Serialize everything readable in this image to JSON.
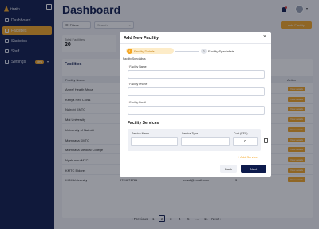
{
  "brand": {
    "name": "Health"
  },
  "sidebar": {
    "items": [
      {
        "label": "Dashboard"
      },
      {
        "label": "Facilities"
      },
      {
        "label": "Statistics"
      },
      {
        "label": "Staff"
      },
      {
        "label": "Settings",
        "badge": "New"
      }
    ]
  },
  "header": {
    "title": "Dashboard"
  },
  "toolbar": {
    "filters_label": "Filters",
    "search_placeholder": "Search",
    "add_facility_label": "Add Facility"
  },
  "stats": {
    "total_label": "Total Facilities",
    "total_value": "20"
  },
  "table": {
    "heading": "Facilities",
    "columns": [
      "Facility Name",
      "Phone",
      "Email",
      "Services",
      "Action"
    ],
    "rows": [
      {
        "name": "Amref Health Africa",
        "phone": "",
        "email": "",
        "services": ""
      },
      {
        "name": "Kenya Red Cross",
        "phone": "",
        "email": "",
        "services": ""
      },
      {
        "name": "Nairobi KMTC",
        "phone": "",
        "email": "",
        "services": ""
      },
      {
        "name": "Moi University",
        "phone": "",
        "email": "",
        "services": ""
      },
      {
        "name": "University of Nairobi",
        "phone": "",
        "email": "",
        "services": ""
      },
      {
        "name": "Mombasa KMTC",
        "phone": "",
        "email": "",
        "services": ""
      },
      {
        "name": "Mombasa Medical College",
        "phone": "",
        "email": "",
        "services": ""
      },
      {
        "name": "Nyahururu MTC",
        "phone": "0724671781",
        "email": "email@email.com",
        "services": "3"
      },
      {
        "name": "KMTC Eldoret",
        "phone": "0724671781",
        "email": "email@email.com",
        "services": "3"
      },
      {
        "name": "KISII University",
        "phone": "0724671781",
        "email": "email@email.com",
        "services": "3"
      }
    ],
    "view_label": "View details"
  },
  "pagination": {
    "prev": "Previous",
    "pages": [
      "1",
      "2",
      "3",
      "4",
      "5",
      "...",
      "11"
    ],
    "current": "2",
    "next": "Next"
  },
  "modal": {
    "title": "Add New Facility",
    "close": "×",
    "steps": [
      {
        "num": "1",
        "label": "Facility Details"
      },
      {
        "num": "2",
        "label": "Facility Specialists"
      }
    ],
    "section_label": "Facility Specialists",
    "fields": [
      {
        "label": "Facility Name"
      },
      {
        "label": "Facility Phone"
      },
      {
        "label": "Facility Email"
      }
    ],
    "services_title": "Facility Services",
    "service_columns": [
      "Service Name",
      "Service Type",
      "Cost (KES)"
    ],
    "cost_value": "0",
    "add_service_label": "+ Add Service",
    "back_label": "Back",
    "next_label": "Next"
  },
  "colors": {
    "primary": "#0d1b4c",
    "accent": "#f5a623"
  }
}
